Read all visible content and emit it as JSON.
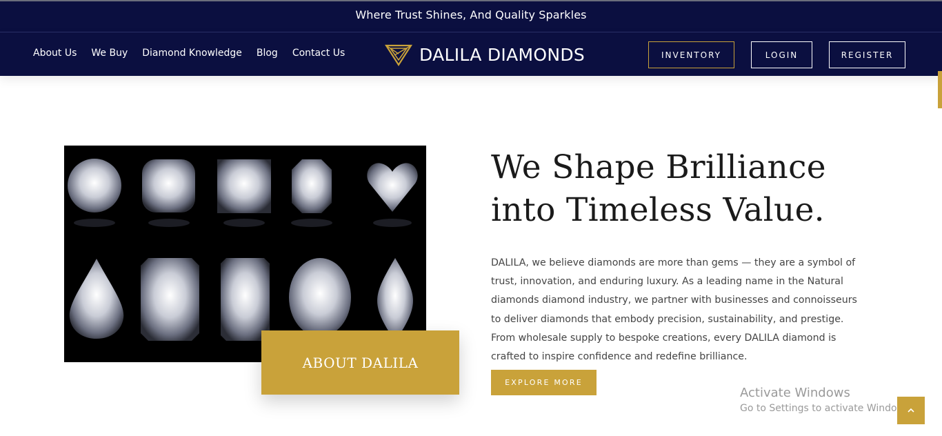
{
  "topbar": {
    "tagline": "Where Trust Shines, And Quality Sparkles"
  },
  "nav": {
    "menu": [
      "About Us",
      "We Buy",
      "Diamond Knowledge",
      "Blog",
      "Contact Us"
    ],
    "logo_text": "DALILA DIAMONDS",
    "buttons": {
      "inventory": "INVENTORY",
      "login": "LOGIN",
      "register": "REGISTER"
    }
  },
  "hero": {
    "image_icon": "diamond-shapes-image",
    "about_label": "ABOUT DALILA",
    "headline_line1": "We Shape Brilliance",
    "headline_line2": "into Timeless Value.",
    "body": "DALILA, we believe diamonds are more than gems — they are a symbol of trust, innovation, and enduring luxury. As a leading name in the Natural diamonds diamond industry, we partner with businesses and connoisseurs to deliver diamonds that embody precision, sustainability, and prestige. From wholesale supply to bespoke creations, every DALILA diamond is crafted to inspire confidence and redefine brilliance.",
    "explore_label": "EXPLORE MORE"
  },
  "windows_watermark": {
    "title": "Activate Windows",
    "subtitle": "Go to Settings to activate Windows."
  },
  "back_to_top_icon": "chevron-up-icon",
  "colors": {
    "navy": "#0b0f40",
    "gold": "#c9a23a",
    "text": "#444444"
  }
}
